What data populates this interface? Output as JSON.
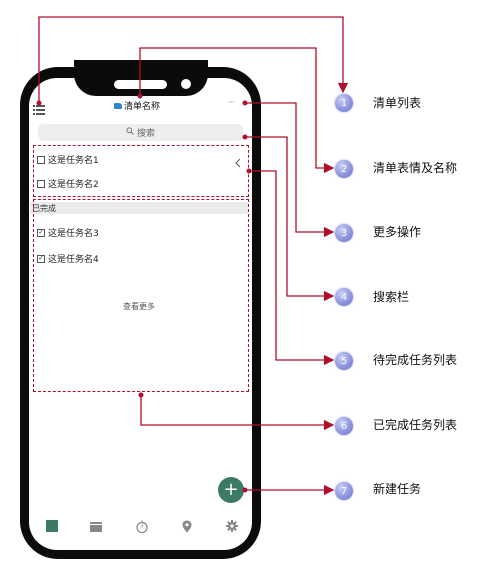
{
  "phone": {
    "title": "清单名称",
    "more": "···",
    "search": "搜索",
    "pending_tasks": [
      {
        "label": "这是任务名1",
        "checked": false
      },
      {
        "label": "这是任务名2",
        "checked": false
      }
    ],
    "completed_header": "已完成",
    "completed_tasks": [
      {
        "label": "这是任务名3",
        "checked": true
      },
      {
        "label": "这是任务名4",
        "checked": true
      }
    ],
    "view_more": "查看更多",
    "fab": "+",
    "tabbar_icons": [
      "task-list-icon",
      "calendar-icon",
      "timer-icon",
      "location-icon",
      "settings-icon"
    ]
  },
  "annotations": [
    {
      "number": "1",
      "label": "清单列表"
    },
    {
      "number": "2",
      "label": "清单表情及名称"
    },
    {
      "number": "3",
      "label": "更多操作"
    },
    {
      "number": "4",
      "label": "搜索栏"
    },
    {
      "number": "5",
      "label": "待完成任务列表"
    },
    {
      "number": "6",
      "label": "已完成任务列表"
    },
    {
      "number": "7",
      "label": "新建任务"
    }
  ],
  "colors": {
    "accent": "#3d7a63",
    "annotation_line": "#b0102c",
    "badge": "#8f96e0"
  }
}
